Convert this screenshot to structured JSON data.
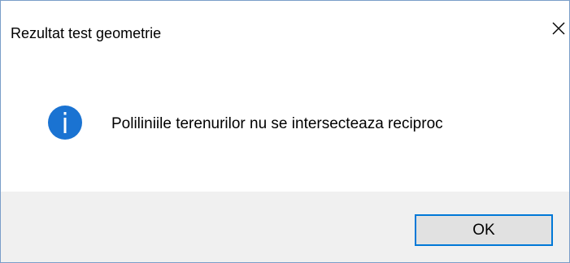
{
  "dialog": {
    "title": "Rezultat test geometrie",
    "close_icon": "close-icon",
    "icon": "information-icon",
    "message": "Poliliniile terenurilor nu se intersecteaza reciproc",
    "ok_label": "OK"
  },
  "colors": {
    "icon_blue": "#1a73d2",
    "button_border": "#0078d7",
    "footer_bg": "#f0f0f0",
    "button_bg": "#e1e1e1"
  }
}
